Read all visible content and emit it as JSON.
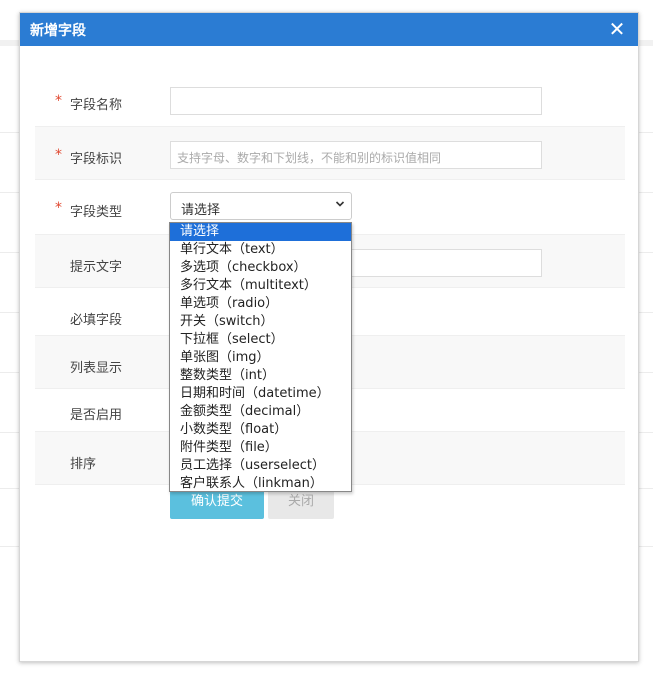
{
  "dialog": {
    "title": "新增字段",
    "close_symbol": "✕"
  },
  "form": {
    "field_name": {
      "required_mark": "*",
      "label": "字段名称",
      "value": ""
    },
    "field_key": {
      "required_mark": "*",
      "label": "字段标识",
      "placeholder": "支持字母、数字和下划线，不能和别的标识值相同"
    },
    "field_type": {
      "required_mark": "*",
      "label": "字段类型",
      "selected": "请选择"
    },
    "hint_text": {
      "label": "提示文字"
    },
    "required_field": {
      "label": "必填字段"
    },
    "list_display": {
      "label": "列表显示"
    },
    "enabled": {
      "label": "是否启用"
    },
    "sort": {
      "label": "排序"
    }
  },
  "dropdown_options": [
    "请选择",
    "单行文本（text）",
    "多选项（checkbox）",
    "多行文本（multitext）",
    "单选项（radio）",
    "开关（switch）",
    "下拉框（select）",
    "单张图（img）",
    "整数类型（int）",
    "日期和时间（datetime）",
    "金额类型（decimal）",
    "小数类型（float）",
    "附件类型（file）",
    "员工选择（userselect）",
    "客户联系人（linkman）"
  ],
  "buttons": {
    "submit": "确认提交",
    "close": "关闭"
  },
  "colors": {
    "header": "#2b7cd3",
    "required": "#e0472f",
    "primary_button": "#5bc0de",
    "selected_option": "#1e6fd9"
  },
  "icons": {
    "close": "close-icon",
    "select_arrow": "chevron-down-icon"
  }
}
